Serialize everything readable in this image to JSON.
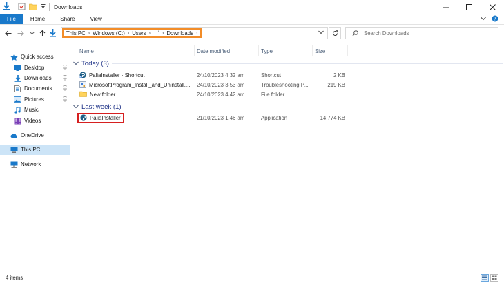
{
  "window": {
    "title": "Downloads"
  },
  "ribbon": {
    "tabs": [
      "File",
      "Home",
      "Share",
      "View"
    ]
  },
  "address": {
    "crumbs": [
      "This PC",
      "Windows (C:)",
      "Users",
      "_ `",
      "Downloads"
    ]
  },
  "search": {
    "placeholder": "Search Downloads"
  },
  "nav": {
    "quick_access": "Quick access",
    "items": [
      {
        "label": "Desktop",
        "icon": "desktop-folder-icon",
        "pinned": true
      },
      {
        "label": "Downloads",
        "icon": "downloads-folder-icon",
        "pinned": true
      },
      {
        "label": "Documents",
        "icon": "documents-folder-icon",
        "pinned": true
      },
      {
        "label": "Pictures",
        "icon": "pictures-folder-icon",
        "pinned": true
      },
      {
        "label": "Music",
        "icon": "music-folder-icon",
        "pinned": false
      },
      {
        "label": "Videos",
        "icon": "videos-folder-icon",
        "pinned": false
      }
    ],
    "onedrive": "OneDrive",
    "this_pc": "This PC",
    "network": "Network"
  },
  "columns": {
    "name": "Name",
    "date": "Date modified",
    "type": "Type",
    "size": "Size"
  },
  "groups": [
    {
      "label": "Today (3)",
      "files": [
        {
          "name": "PaliaInstaller - Shortcut",
          "date": "24/10/2023 4:32 am",
          "type": "Shortcut",
          "size": "2 KB",
          "icon": "palia-shortcut-icon"
        },
        {
          "name": "MicrosoftProgram_Install_and_Uninstall....",
          "date": "24/10/2023 3:53 am",
          "type": "Troubleshooting P...",
          "size": "219 KB",
          "icon": "troubleshooter-icon"
        },
        {
          "name": "New folder",
          "date": "24/10/2023 4:42 am",
          "type": "File folder",
          "size": "",
          "icon": "folder-icon"
        }
      ]
    },
    {
      "label": "Last week (1)",
      "files": [
        {
          "name": "PaliaInstaller",
          "date": "21/10/2023 1:46 am",
          "type": "Application",
          "size": "14,774 KB",
          "icon": "palia-app-icon"
        }
      ]
    }
  ],
  "status": {
    "item_count": "4 items"
  },
  "colors": {
    "accent": "#1979ca",
    "highlight_orange": "#f28c28",
    "highlight_red": "#d62020",
    "selection": "#cce4f7",
    "group_text": "#1e3287"
  }
}
